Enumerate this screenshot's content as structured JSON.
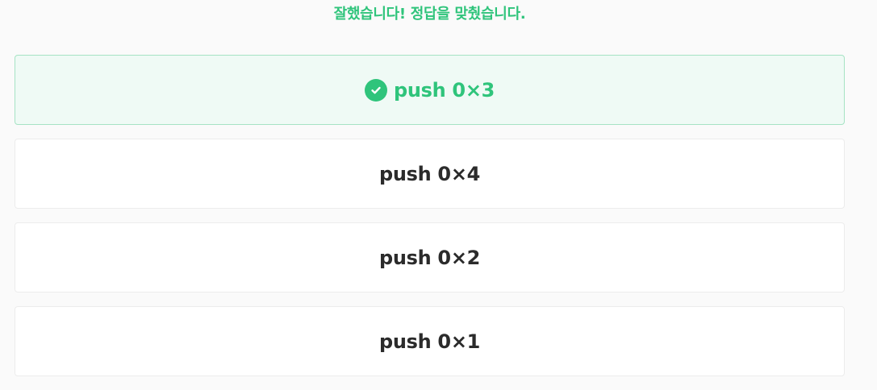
{
  "feedback": {
    "message": "잘했습니다! 정답을 맞췄습니다."
  },
  "options": [
    {
      "label": "push 0×3",
      "state": "correct",
      "icon": "check-circle-icon"
    },
    {
      "label": "push 0×4",
      "state": "default"
    },
    {
      "label": "push 0×2",
      "state": "default"
    },
    {
      "label": "push 0×1",
      "state": "default"
    }
  ],
  "colors": {
    "success": "#2fc47b",
    "success_bg": "#effaf5",
    "success_border": "#a6e3c4",
    "text": "#2b2b2b",
    "card_border": "#ececec",
    "page_bg": "#fafafa"
  }
}
